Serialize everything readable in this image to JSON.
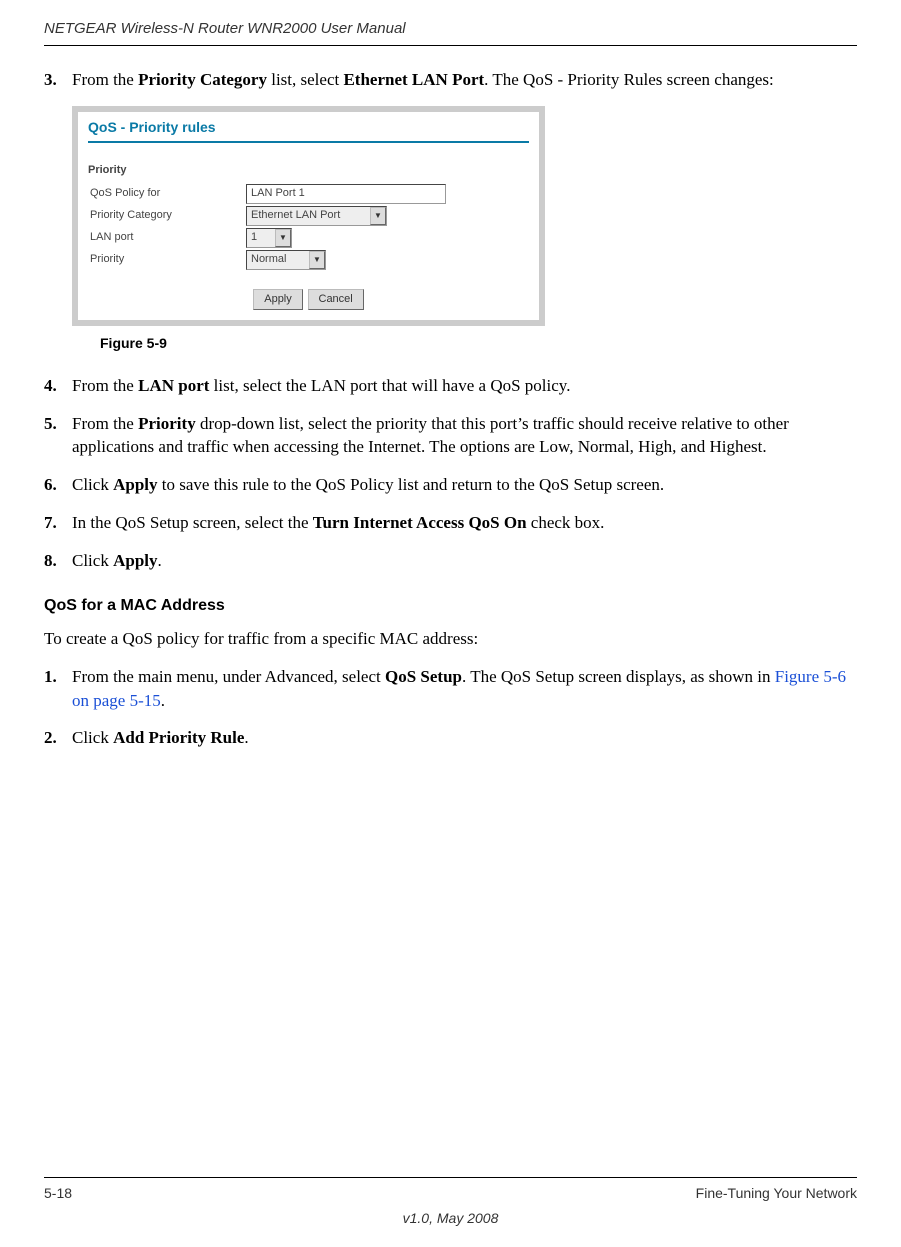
{
  "header": {
    "title": "NETGEAR Wireless-N Router WNR2000 User Manual"
  },
  "step3": {
    "num": "3.",
    "pre": "From the ",
    "b1": "Priority Category",
    "mid1": " list, select ",
    "b2": "Ethernet LAN Port",
    "post": ". The QoS - Priority Rules screen changes:"
  },
  "figure": {
    "title": "QoS - Priority rules",
    "sub": "Priority",
    "rows": {
      "policy_label": "QoS Policy for",
      "policy_value": "LAN Port 1",
      "category_label": "Priority Category",
      "category_value": "Ethernet LAN Port",
      "lanport_label": "LAN port",
      "lanport_value": "1",
      "priority_label": "Priority",
      "priority_value": "Normal"
    },
    "apply": "Apply",
    "cancel": "Cancel",
    "caption": "Figure 5-9"
  },
  "step4": {
    "num": "4.",
    "pre": "From the ",
    "b1": "LAN port",
    "post": " list, select the LAN port that will have a QoS policy."
  },
  "step5": {
    "num": "5.",
    "pre": "From the ",
    "b1": "Priority",
    "post": " drop-down list, select the priority that this port’s traffic should receive relative to other applications and traffic when accessing the Internet. The options are Low, Normal, High, and Highest."
  },
  "step6": {
    "num": "6.",
    "pre": "Click ",
    "b1": "Apply",
    "post": " to save this rule to the QoS Policy list and return to the QoS Setup screen."
  },
  "step7": {
    "num": "7.",
    "pre": "In the QoS Setup screen, select the ",
    "b1": "Turn Internet Access QoS On",
    "post": " check box."
  },
  "step8": {
    "num": "8.",
    "pre": "Click ",
    "b1": "Apply",
    "post": "."
  },
  "subhead": "QoS for a MAC Address",
  "intro": "To create a QoS policy for traffic from a specific MAC address:",
  "mstep1": {
    "num": "1.",
    "pre": "From the main menu, under Advanced, select ",
    "b1": "QoS Setup",
    "mid": ". The QoS Setup screen displays, as shown in ",
    "link": "Figure 5-6 on page 5-15",
    "post": "."
  },
  "mstep2": {
    "num": "2.",
    "pre": "Click ",
    "b1": "Add Priority Rule",
    "post": "."
  },
  "footer": {
    "page": "5-18",
    "section": "Fine-Tuning Your Network",
    "version": "v1.0, May 2008"
  }
}
